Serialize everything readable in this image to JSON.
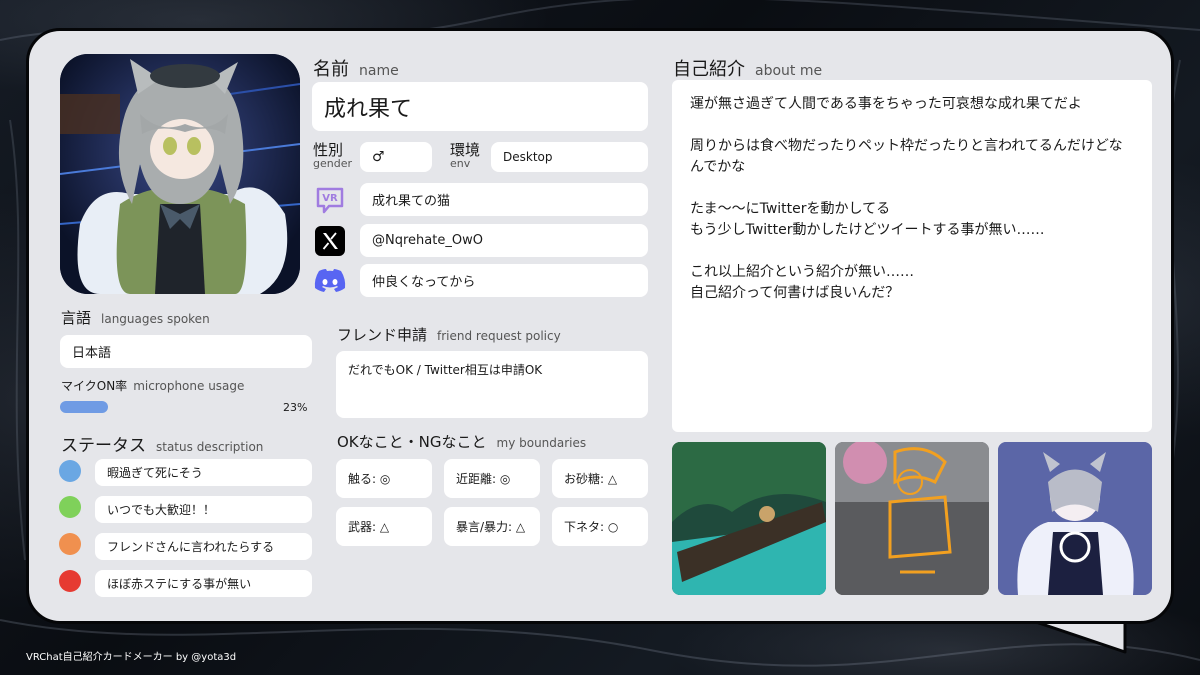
{
  "profile": {
    "name_label_jp": "名前",
    "name_label_en": "name",
    "name_value": "成れ果て",
    "gender_label_jp": "性別",
    "gender_label_en": "gender",
    "gender_value": "♂",
    "env_label_jp": "環境",
    "env_label_en": "env",
    "env_value": "Desktop",
    "vrchat_name": "成れ果ての猫",
    "twitter_handle": "@Nqrehate_OwO",
    "discord_policy": "仲良くなってから",
    "vr_icon_text": "VR"
  },
  "languages": {
    "label_jp": "言語",
    "label_en": "languages spoken",
    "value": "日本語"
  },
  "mic": {
    "label_jp": "マイクON率",
    "label_en": "microphone usage",
    "percent": 23,
    "percent_text": "23%"
  },
  "status": {
    "label_jp": "ステータス",
    "label_en": "status description",
    "items": [
      {
        "color": "#6aa7e3",
        "text": "暇過ぎて死にそう"
      },
      {
        "color": "#7fd15a",
        "text": "いつでも大歓迎！！"
      },
      {
        "color": "#f0904f",
        "text": "フレンドさんに言われたらする"
      },
      {
        "color": "#e63a32",
        "text": "ほぼ赤ステにする事が無い"
      }
    ]
  },
  "friend_request": {
    "label_jp": "フレンド申請",
    "label_en": "friend request policy",
    "value": "だれでもOK / Twitter相互は申請OK"
  },
  "boundaries": {
    "label_jp": "OKなこと・NGなこと",
    "label_en": "my boundaries",
    "items": [
      "触る: ◎",
      "近距離: ◎",
      "お砂糖: △",
      "武器: △",
      "暴言/暴力: △",
      "下ネタ: ○"
    ]
  },
  "about": {
    "label_jp": "自己紹介",
    "label_en": "about me",
    "text": "運が無さ過ぎて人間である事をちゃった可哀想な成れ果てだよ\n\n周りからは食べ物だったりペット枠だったりと言われてるんだけどなんでかな\n\nたま〜〜にTwitterを動かしてる\nもう少しTwitter動かしたけどツイートする事が無い……\n\nこれ以上紹介という紹介が無い……\n自己紹介って何書けば良いんだ？"
  },
  "footer": {
    "text": "VRChat自己紹介カードメーカー by @yota3d"
  },
  "colors": {
    "card_bg": "#e5e6ea",
    "mic_bar": "#6f9be4",
    "vr_icon": "#a07ce0",
    "discord": "#5865f2"
  }
}
